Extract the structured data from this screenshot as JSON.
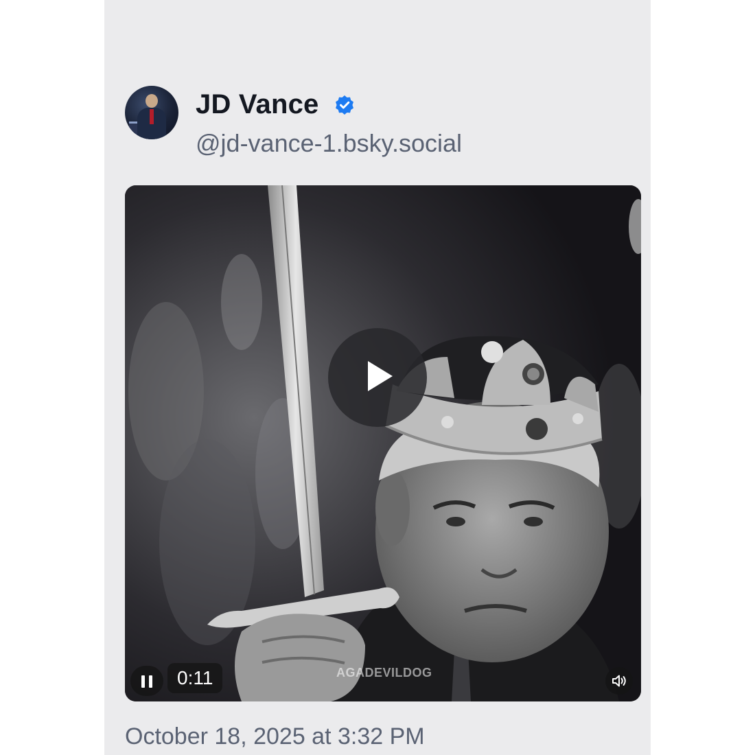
{
  "post": {
    "author": {
      "display_name": "JD Vance",
      "handle": "@jd-vance-1.bsky.social",
      "verified_icon": "verified-check-icon",
      "avatar": "avatar"
    },
    "video": {
      "elapsed": "0:11",
      "watermark": "AGADEVILDOG",
      "play_icon": "play-icon",
      "pause_icon": "pause-icon",
      "mute_icon": "speaker-icon"
    },
    "timestamp": "October 18, 2025 at 3:32 PM"
  },
  "colors": {
    "card_background": "#ebebed",
    "name_text": "#141821",
    "secondary_text": "#5a6273",
    "verified_blue": "#1d7bf2"
  }
}
